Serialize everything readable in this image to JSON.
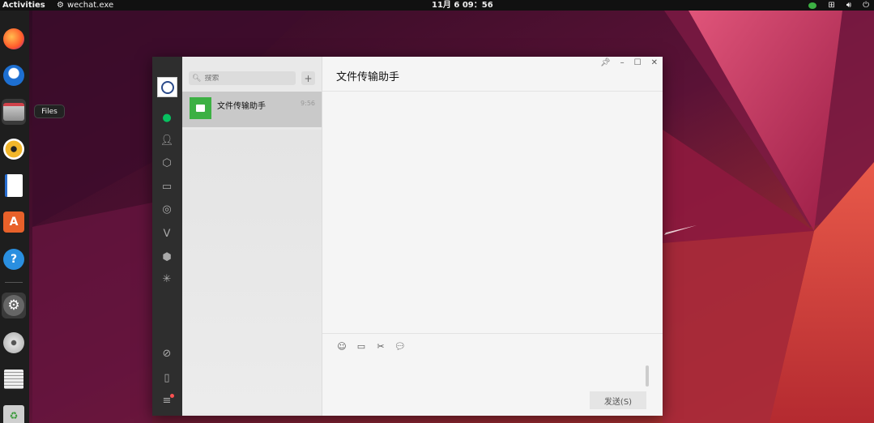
{
  "topbar": {
    "activities": "Activities",
    "app_name": "wechat.exe",
    "clock": "11月 6  09：56"
  },
  "dock": {
    "tooltip": "Files"
  },
  "wechat": {
    "search": {
      "placeholder": "搜索"
    },
    "chats": [
      {
        "name": "文件传输助手",
        "time": "9:56"
      }
    ],
    "conversation_title": "文件传输助手",
    "send_label": "发送(S)"
  },
  "colors": {
    "accent": "#07c160",
    "file_helper": "#3cb043",
    "badge": "#fa5151"
  }
}
